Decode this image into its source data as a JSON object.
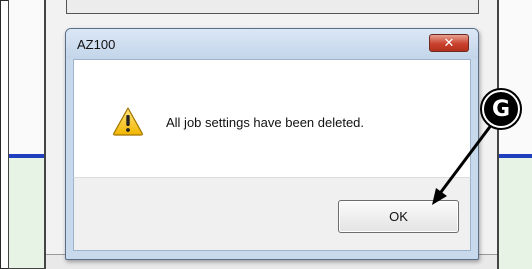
{
  "dialog": {
    "title": "AZ100",
    "message": "All job settings have been deleted.",
    "ok_label": "OK",
    "close_glyph": "✕",
    "warning_icon": "warning-triangle-icon"
  },
  "callout": {
    "letter": "G"
  },
  "colors": {
    "titlebar": "#c9d9ec",
    "close_button": "#c9412c",
    "accent_blue_rule": "#1f3fbf",
    "background_green": "#e7f3e4"
  }
}
